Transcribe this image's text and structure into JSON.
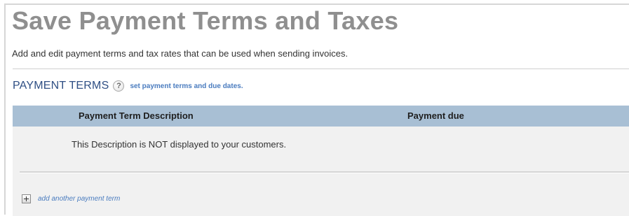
{
  "page": {
    "title": "Save Payment Terms and Taxes",
    "subtitle": "Add and edit payment terms and tax rates that can be used when sending invoices."
  },
  "payment_terms": {
    "section_title": "PAYMENT TERMS",
    "help_glyph": "?",
    "help_link": "set payment terms and due dates.",
    "table": {
      "columns": [
        "Payment Term Description",
        "Payment due"
      ],
      "description_note": "This Description is NOT displayed to your customers."
    },
    "add_link": "add another payment term"
  },
  "colors": {
    "title": "#8f8f8f",
    "section_title": "#2f4f84",
    "link": "#4a7cbf",
    "table_header_bg": "#a8bfd4",
    "table_body_bg": "#f1f1f1"
  },
  "icons": {
    "help": "question-mark-circle",
    "add": "plus-square"
  }
}
